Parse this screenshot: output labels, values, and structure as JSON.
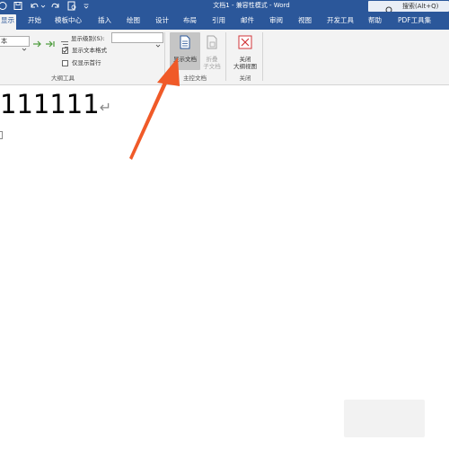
{
  "titlebar": {
    "title": "文档1 - 兼容性模式 - Word",
    "search_placeholder": "搜索(Alt+Q)",
    "bg_color": "#2b579a"
  },
  "quick_access": [
    "save-as-icon",
    "save-icon",
    "undo-icon",
    "redo-icon",
    "print-preview-icon",
    "customize-qat-icon"
  ],
  "tabs": [
    "显示",
    "开始",
    "模板中心",
    "插入",
    "绘图",
    "设计",
    "布局",
    "引用",
    "邮件",
    "审阅",
    "视图",
    "开发工具",
    "帮助",
    "PDF工具集"
  ],
  "active_tab": "显示",
  "outline_tools": {
    "level_value": "本",
    "show_level_label": "显示级别(S):",
    "show_level_value": "",
    "show_text_format_label": "显示文本格式",
    "show_text_format_checked": true,
    "first_line_only_label": "仅显示首行",
    "first_line_only_checked": false,
    "group_label": "大纲工具"
  },
  "master_document": {
    "show_document_label": "显示文档",
    "collapse_subdocs_label_1": "折叠",
    "collapse_subdocs_label_2": "子文档",
    "group_label": "主控文档"
  },
  "close_group": {
    "close_label_1": "关闭",
    "close_label_2": "大纲视图",
    "group_label": "关闭"
  },
  "document": {
    "text": "111111",
    "paragraph_mark": "↵"
  },
  "annotation": {
    "arrow_color": "#f05a28"
  }
}
